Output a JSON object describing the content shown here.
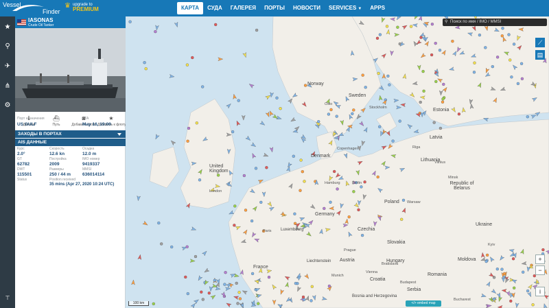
{
  "header": {
    "logo_line1": "Vessel",
    "logo_line2": "Finder",
    "premium_line1": "upgrade to",
    "premium_line2": "PREMIUM",
    "nav": [
      {
        "label": "КАРТА",
        "active": true
      },
      {
        "label": "СУДА",
        "active": false
      },
      {
        "label": "ГАЛЕРЕЯ",
        "active": false
      },
      {
        "label": "ПОРТЫ",
        "active": false
      },
      {
        "label": "НОВОСТИ",
        "active": false
      },
      {
        "label": "SERVICES",
        "active": false,
        "dropdown": true
      },
      {
        "label": "APPS",
        "active": false
      }
    ]
  },
  "leftbar": {
    "icons": [
      "star-icon",
      "map-pin-icon",
      "satellite-icon",
      "route-icon",
      "gear-icon",
      "antenna-icon"
    ]
  },
  "vessel": {
    "name": "IASONAS",
    "type": "Crude Oil Tanker",
    "actions": [
      {
        "label": "Детали",
        "icon": "info-icon",
        "glyph": "ℹ"
      },
      {
        "label": "Путь",
        "icon": "ship-icon",
        "glyph": "⛴"
      },
      {
        "label": "Добавить фото",
        "icon": "camera-icon",
        "glyph": "◙"
      },
      {
        "label": "Добавить к флоту",
        "icon": "star-icon",
        "glyph": "★"
      }
    ],
    "dest_label": "Порт назначения",
    "dest_value": "US GULF",
    "eta_label": "ETA",
    "eta_value": "May 16, 19:00",
    "port_calls_label": "ЗАХОДЫ В ПОРТАХ",
    "ais_label": "AIS ДАННЫЕ",
    "fields": [
      {
        "label": "Курс",
        "value": "2.0°"
      },
      {
        "label": "Скорость",
        "value": "12.6 kn"
      },
      {
        "label": "Осадка",
        "value": "12.0 m"
      },
      {
        "label": "GT",
        "value": "62782"
      },
      {
        "label": "Постройка",
        "value": "2009"
      },
      {
        "label": "IMO номер",
        "value": "9419337"
      },
      {
        "label": "DWT",
        "value": "115501"
      },
      {
        "label": "Размеры",
        "value": "250 / 44 m"
      },
      {
        "label": "MMSI",
        "value": "636014114"
      }
    ],
    "status_label": "Status",
    "position_label": "Position received",
    "position_value": "35 mins (Apr 27, 2020 10:24 UTC)"
  },
  "map": {
    "search_placeholder": "Поиск по имя / IMO / MMSI",
    "zoom_in": "+",
    "zoom_out": "−",
    "scale_label": "100 km",
    "embed_label": "</> embed map",
    "places": [
      {
        "label": "Norway"
      },
      {
        "label": "Sweden"
      },
      {
        "label": "Estonia"
      },
      {
        "label": "Latvia"
      },
      {
        "label": "Lithuania"
      },
      {
        "label": "Republic of Belarus"
      },
      {
        "label": "Denmark"
      },
      {
        "label": "United Kingdom"
      },
      {
        "label": "Poland"
      },
      {
        "label": "Germany"
      },
      {
        "label": "Czechia"
      },
      {
        "label": "Slovakia"
      },
      {
        "label": "Hungary"
      },
      {
        "label": "Luxembourg"
      },
      {
        "label": "Liechtenstein"
      },
      {
        "label": "Austria"
      },
      {
        "label": "Croatia"
      },
      {
        "label": "Romania"
      },
      {
        "label": "Moldova"
      },
      {
        "label": "Ukraine"
      },
      {
        "label": "Serbia"
      },
      {
        "label": "Bosnia and Herzegovina"
      },
      {
        "label": "France"
      }
    ],
    "cities": [
      "Riga",
      "Berlin",
      "Hamburg",
      "Prague",
      "Vienna",
      "Budapest",
      "Munich",
      "Oslo",
      "Stockholm",
      "Copenhagen",
      "London",
      "Paris",
      "Warsaw",
      "Minsk",
      "Vilnius",
      "Kyiv",
      "Bucharest",
      "Bratislava"
    ],
    "colors": {
      "land": "#f2efe9",
      "water": "#cfe3f0",
      "accent": "#1778b7"
    }
  }
}
